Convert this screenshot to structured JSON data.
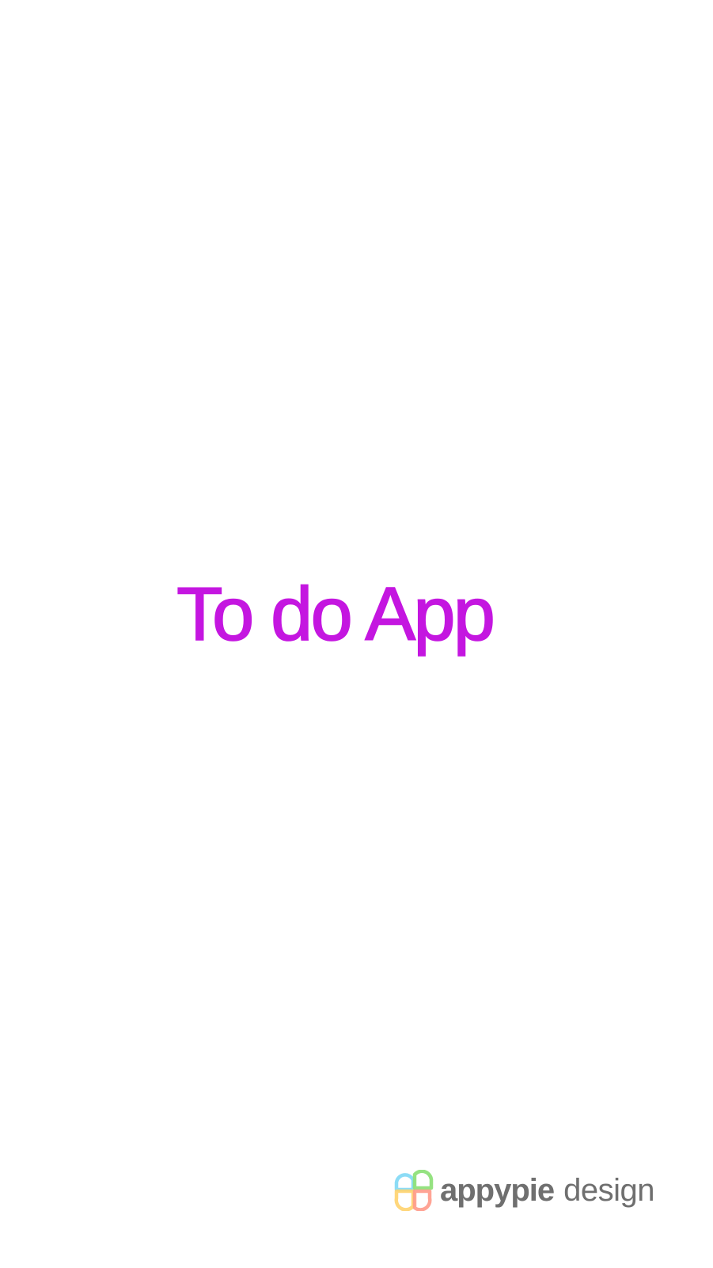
{
  "splash": {
    "title": "To do App",
    "title_color": "#c416e0",
    "background": "#ffffff"
  },
  "watermark": {
    "brand": "appypie",
    "suffix": "design",
    "logo_icon": "appypie-petal-logo-icon",
    "logo_colors": [
      "#7fd8f5",
      "#8fe07a",
      "#ffd36e",
      "#ff9a8a"
    ]
  }
}
